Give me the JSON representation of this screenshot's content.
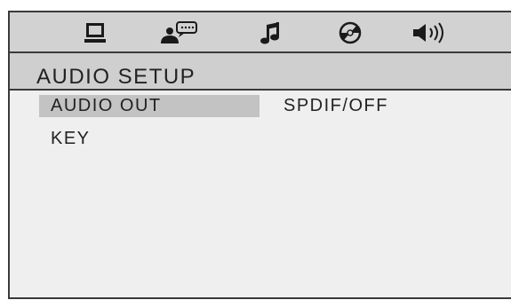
{
  "icons": [
    {
      "name": "monitor-icon",
      "label": "General setup"
    },
    {
      "name": "speaker-person-icon",
      "label": "Language setup"
    },
    {
      "name": "music-note-icon",
      "label": "Audio setup"
    },
    {
      "name": "disc-icon",
      "label": "Video setup"
    },
    {
      "name": "speaker-volume-icon",
      "label": "Speaker setup"
    }
  ],
  "page": {
    "title": "AUDIO SETUP"
  },
  "menu": {
    "items": [
      {
        "label": "AUDIO OUT",
        "value": "SPDIF/OFF",
        "selected": true
      },
      {
        "label": "KEY",
        "value": "",
        "selected": false
      }
    ]
  },
  "colors": {
    "background": "#efefef",
    "header": "#d2d2d2",
    "selection": "#c3c3c3",
    "text": "#222222"
  }
}
